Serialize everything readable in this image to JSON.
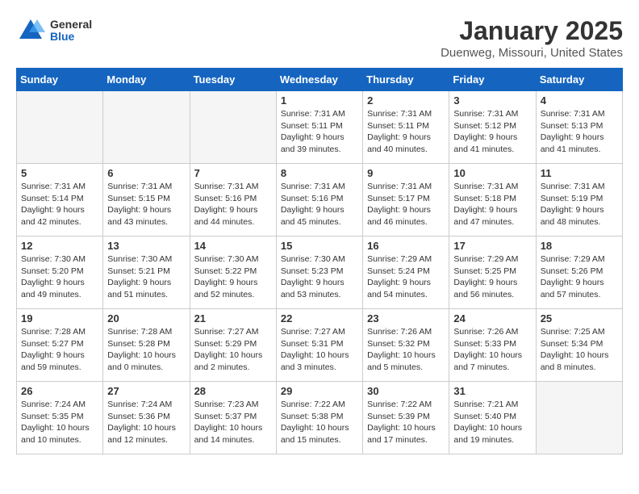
{
  "header": {
    "logo_general": "General",
    "logo_blue": "Blue",
    "month_title": "January 2025",
    "location": "Duenweg, Missouri, United States"
  },
  "weekdays": [
    "Sunday",
    "Monday",
    "Tuesday",
    "Wednesday",
    "Thursday",
    "Friday",
    "Saturday"
  ],
  "weeks": [
    [
      {
        "day": "",
        "info": ""
      },
      {
        "day": "",
        "info": ""
      },
      {
        "day": "",
        "info": ""
      },
      {
        "day": "1",
        "info": "Sunrise: 7:31 AM\nSunset: 5:11 PM\nDaylight: 9 hours\nand 39 minutes."
      },
      {
        "day": "2",
        "info": "Sunrise: 7:31 AM\nSunset: 5:11 PM\nDaylight: 9 hours\nand 40 minutes."
      },
      {
        "day": "3",
        "info": "Sunrise: 7:31 AM\nSunset: 5:12 PM\nDaylight: 9 hours\nand 41 minutes."
      },
      {
        "day": "4",
        "info": "Sunrise: 7:31 AM\nSunset: 5:13 PM\nDaylight: 9 hours\nand 41 minutes."
      }
    ],
    [
      {
        "day": "5",
        "info": "Sunrise: 7:31 AM\nSunset: 5:14 PM\nDaylight: 9 hours\nand 42 minutes."
      },
      {
        "day": "6",
        "info": "Sunrise: 7:31 AM\nSunset: 5:15 PM\nDaylight: 9 hours\nand 43 minutes."
      },
      {
        "day": "7",
        "info": "Sunrise: 7:31 AM\nSunset: 5:16 PM\nDaylight: 9 hours\nand 44 minutes."
      },
      {
        "day": "8",
        "info": "Sunrise: 7:31 AM\nSunset: 5:16 PM\nDaylight: 9 hours\nand 45 minutes."
      },
      {
        "day": "9",
        "info": "Sunrise: 7:31 AM\nSunset: 5:17 PM\nDaylight: 9 hours\nand 46 minutes."
      },
      {
        "day": "10",
        "info": "Sunrise: 7:31 AM\nSunset: 5:18 PM\nDaylight: 9 hours\nand 47 minutes."
      },
      {
        "day": "11",
        "info": "Sunrise: 7:31 AM\nSunset: 5:19 PM\nDaylight: 9 hours\nand 48 minutes."
      }
    ],
    [
      {
        "day": "12",
        "info": "Sunrise: 7:30 AM\nSunset: 5:20 PM\nDaylight: 9 hours\nand 49 minutes."
      },
      {
        "day": "13",
        "info": "Sunrise: 7:30 AM\nSunset: 5:21 PM\nDaylight: 9 hours\nand 51 minutes."
      },
      {
        "day": "14",
        "info": "Sunrise: 7:30 AM\nSunset: 5:22 PM\nDaylight: 9 hours\nand 52 minutes."
      },
      {
        "day": "15",
        "info": "Sunrise: 7:30 AM\nSunset: 5:23 PM\nDaylight: 9 hours\nand 53 minutes."
      },
      {
        "day": "16",
        "info": "Sunrise: 7:29 AM\nSunset: 5:24 PM\nDaylight: 9 hours\nand 54 minutes."
      },
      {
        "day": "17",
        "info": "Sunrise: 7:29 AM\nSunset: 5:25 PM\nDaylight: 9 hours\nand 56 minutes."
      },
      {
        "day": "18",
        "info": "Sunrise: 7:29 AM\nSunset: 5:26 PM\nDaylight: 9 hours\nand 57 minutes."
      }
    ],
    [
      {
        "day": "19",
        "info": "Sunrise: 7:28 AM\nSunset: 5:27 PM\nDaylight: 9 hours\nand 59 minutes."
      },
      {
        "day": "20",
        "info": "Sunrise: 7:28 AM\nSunset: 5:28 PM\nDaylight: 10 hours\nand 0 minutes."
      },
      {
        "day": "21",
        "info": "Sunrise: 7:27 AM\nSunset: 5:29 PM\nDaylight: 10 hours\nand 2 minutes."
      },
      {
        "day": "22",
        "info": "Sunrise: 7:27 AM\nSunset: 5:31 PM\nDaylight: 10 hours\nand 3 minutes."
      },
      {
        "day": "23",
        "info": "Sunrise: 7:26 AM\nSunset: 5:32 PM\nDaylight: 10 hours\nand 5 minutes."
      },
      {
        "day": "24",
        "info": "Sunrise: 7:26 AM\nSunset: 5:33 PM\nDaylight: 10 hours\nand 7 minutes."
      },
      {
        "day": "25",
        "info": "Sunrise: 7:25 AM\nSunset: 5:34 PM\nDaylight: 10 hours\nand 8 minutes."
      }
    ],
    [
      {
        "day": "26",
        "info": "Sunrise: 7:24 AM\nSunset: 5:35 PM\nDaylight: 10 hours\nand 10 minutes."
      },
      {
        "day": "27",
        "info": "Sunrise: 7:24 AM\nSunset: 5:36 PM\nDaylight: 10 hours\nand 12 minutes."
      },
      {
        "day": "28",
        "info": "Sunrise: 7:23 AM\nSunset: 5:37 PM\nDaylight: 10 hours\nand 14 minutes."
      },
      {
        "day": "29",
        "info": "Sunrise: 7:22 AM\nSunset: 5:38 PM\nDaylight: 10 hours\nand 15 minutes."
      },
      {
        "day": "30",
        "info": "Sunrise: 7:22 AM\nSunset: 5:39 PM\nDaylight: 10 hours\nand 17 minutes."
      },
      {
        "day": "31",
        "info": "Sunrise: 7:21 AM\nSunset: 5:40 PM\nDaylight: 10 hours\nand 19 minutes."
      },
      {
        "day": "",
        "info": ""
      }
    ]
  ]
}
